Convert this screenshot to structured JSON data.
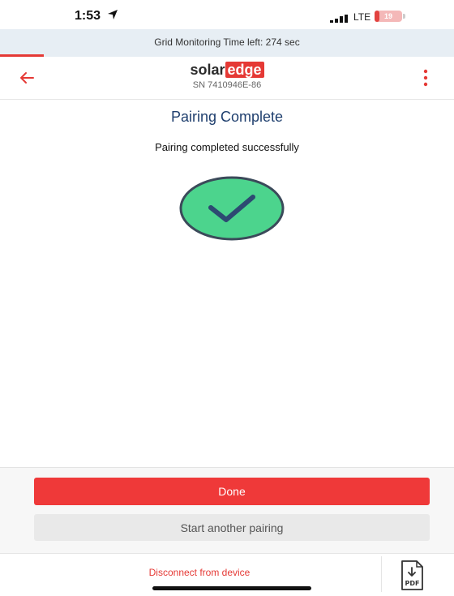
{
  "status_bar": {
    "time": "1:53",
    "network": "LTE",
    "battery_level": "19",
    "battery_fraction": 0.19
  },
  "grid_banner": {
    "text": "Grid Monitoring Time left: 274 sec"
  },
  "header": {
    "logo_solar": "solar",
    "logo_edge": "edge",
    "serial": "SN 7410946E-86"
  },
  "main": {
    "title": "Pairing Complete",
    "message": "Pairing completed successfully"
  },
  "actions": {
    "done_label": "Done",
    "another_label": "Start another pairing"
  },
  "footer": {
    "disconnect_label": "Disconnect from device",
    "pdf_label": "PDF"
  },
  "colors": {
    "accent_red": "#e53935",
    "success_green": "#4cd48d",
    "title_navy": "#1f3f6e"
  },
  "icons": {
    "back": "arrow-left-icon",
    "menu": "kebab-menu-icon",
    "success": "check-circle-icon",
    "pdf": "pdf-download-icon"
  }
}
